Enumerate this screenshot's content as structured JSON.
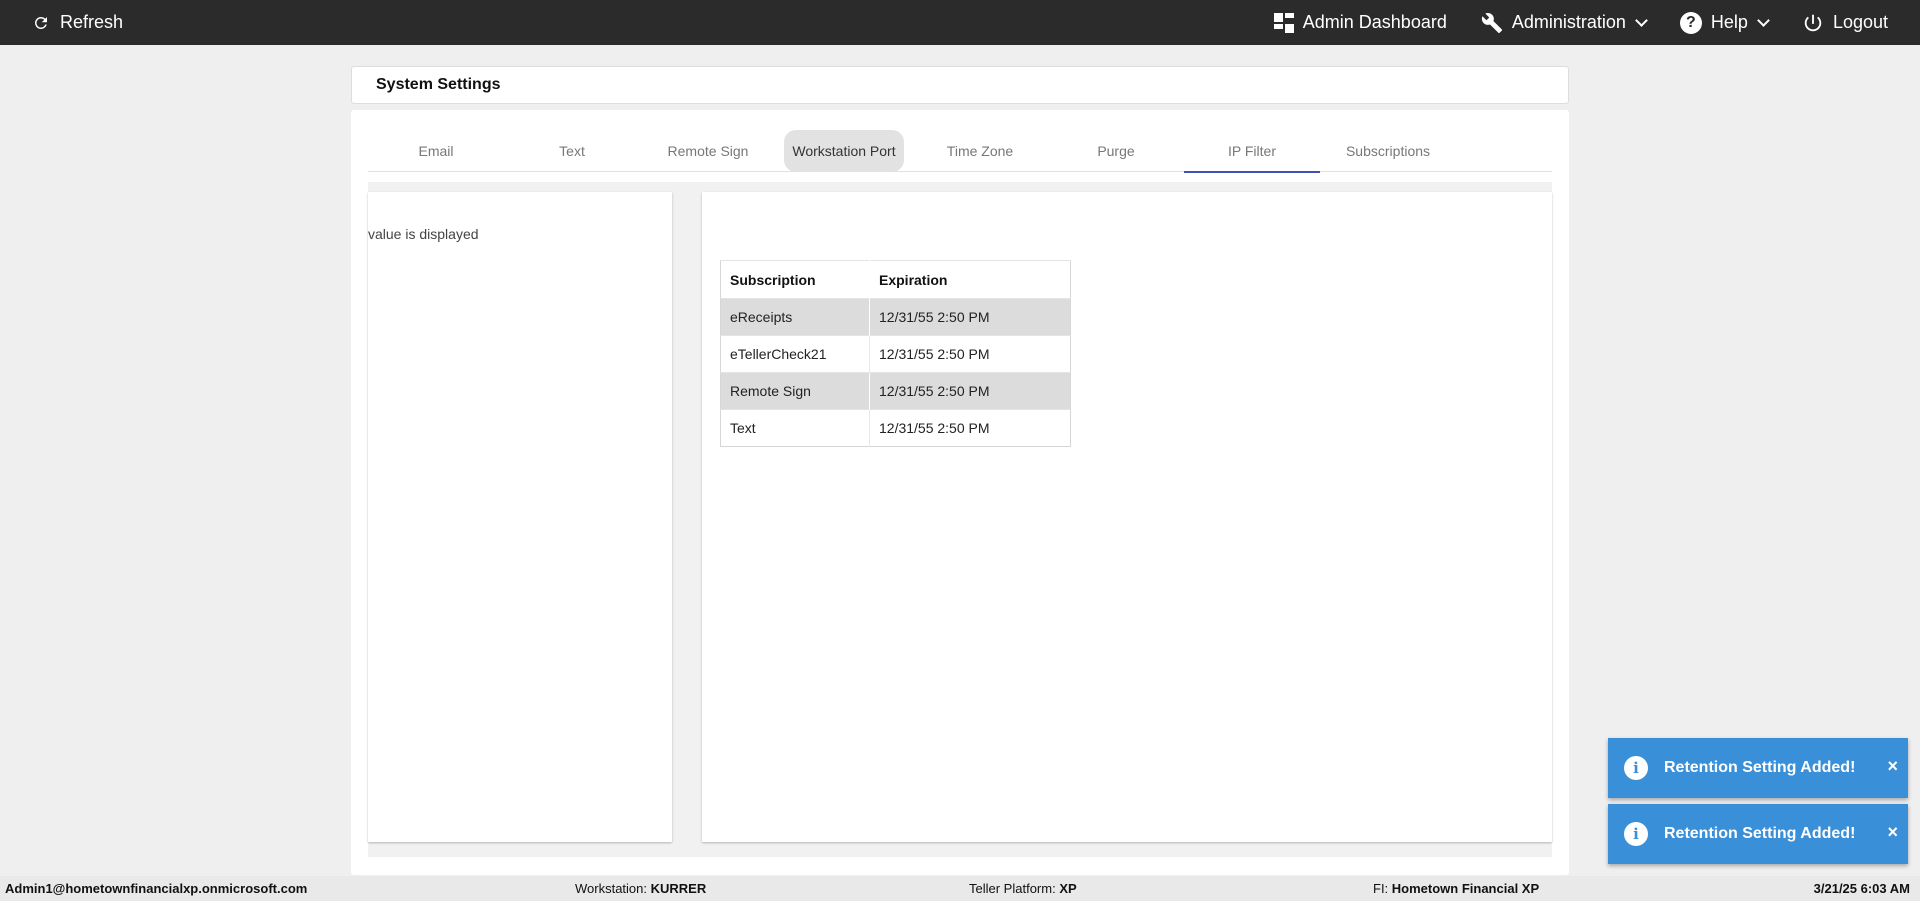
{
  "topbar": {
    "refresh_label": "Refresh",
    "nav": {
      "admin_dashboard": "Admin Dashboard",
      "administration": "Administration",
      "help": "Help",
      "logout": "Logout"
    }
  },
  "page": {
    "title": "System Settings"
  },
  "tabs": [
    "Email",
    "Text",
    "Remote Sign",
    "Workstation Port",
    "Time Zone",
    "Purge",
    "IP Filter",
    "Subscriptions"
  ],
  "left_panel": {
    "text": "value is displayed"
  },
  "subscriptions_table": {
    "headers": [
      "Subscription",
      "Expiration"
    ],
    "rows": [
      [
        "eReceipts",
        "12/31/55 2:50 PM"
      ],
      [
        "eTellerCheck21",
        "12/31/55 2:50 PM"
      ],
      [
        "Remote Sign",
        "12/31/55 2:50 PM"
      ],
      [
        "Text",
        "12/31/55 2:50 PM"
      ]
    ]
  },
  "toasts": [
    {
      "message": "Retention Setting Added!",
      "close": "×"
    },
    {
      "message": "Retention Setting Added!",
      "close": "×"
    }
  ],
  "footer": {
    "user": "Admin1@hometownfinancialxp.onmicrosoft.com",
    "workstation_label": "Workstation: ",
    "workstation_value": "KURRER",
    "platform_label": "Teller Platform: ",
    "platform_value": "XP",
    "fi_label": "FI: ",
    "fi_value": "Hometown Financial XP",
    "datetime": "3/21/25 6:03 AM"
  },
  "colors": {
    "topbar": "#2b2b2b",
    "tab_active_underline": "#3f51b5",
    "toast": "#3a8fd9"
  }
}
